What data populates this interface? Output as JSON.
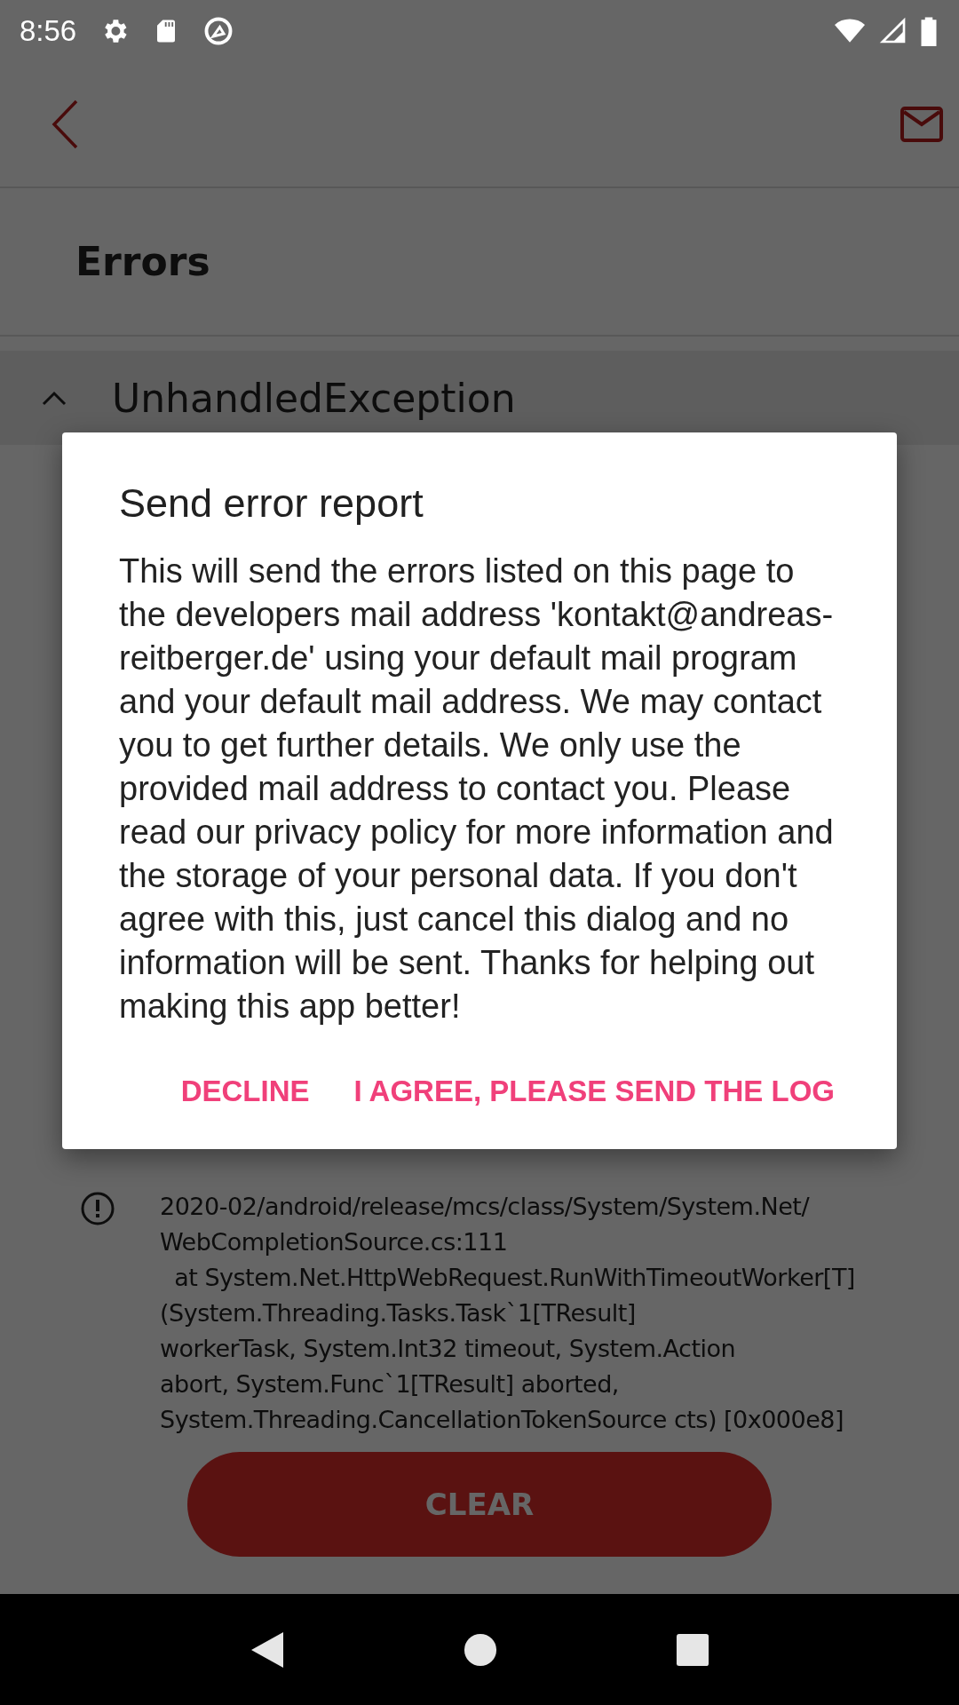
{
  "status_bar": {
    "time": "8:56"
  },
  "page": {
    "title": "Errors",
    "exception": {
      "title": "UnhandledException",
      "expanded": true,
      "log": [
        "2020-02/android/release/mcs/class/System/System.Net/",
        "WebCompletionSource.cs:111",
        "  at System.Net.HttpWebRequest.RunWithTimeoutWorker[T]",
        "(System.Threading.Tasks.Task`1[TResult]",
        "workerTask, System.Int32 timeout, System.Action",
        "abort, System.Func`1[TResult] aborted,",
        "System.Threading.CancellationTokenSource cts) [0x000e8]"
      ]
    },
    "clear_button": "CLEAR"
  },
  "dialog": {
    "title": "Send error report",
    "message": "This will send the errors listed on this page to the developers mail address 'kontakt@andreas-reitberger.de' using your default mail program and your default mail address. We may contact you to get further details. We only use the provided mail address to contact you. Please read our privacy policy for more information and the storage of your personal data. If you don't agree with this, just cancel this dialog and no information will be sent. Thanks for helping out making this app better!",
    "buttons": [
      "DECLINE",
      "I AGREE, PLEASE SEND THE LOG"
    ]
  }
}
